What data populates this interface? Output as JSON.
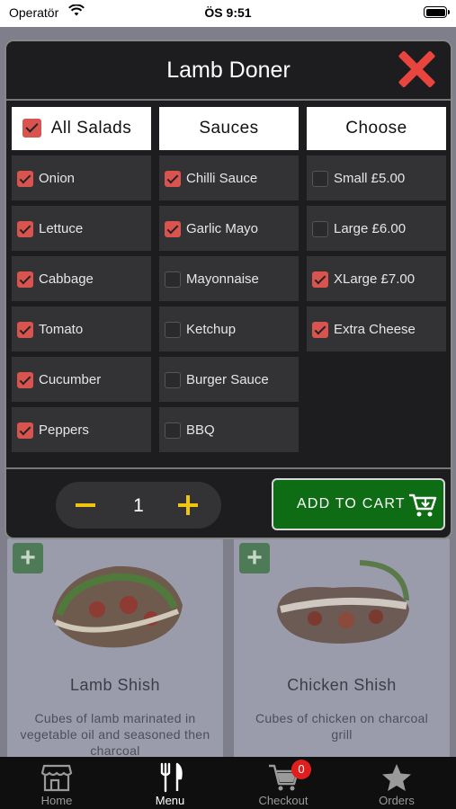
{
  "status_bar": {
    "carrier": "Operatör",
    "time": "ÖS 9:51"
  },
  "modal": {
    "title": "Lamb Doner",
    "columns": [
      {
        "header": "All Salads",
        "header_checked": true,
        "options": [
          {
            "label": "Onion",
            "checked": true
          },
          {
            "label": "Lettuce",
            "checked": true
          },
          {
            "label": "Cabbage",
            "checked": true
          },
          {
            "label": "Tomato",
            "checked": true
          },
          {
            "label": "Cucumber",
            "checked": true
          },
          {
            "label": "Peppers",
            "checked": true
          }
        ]
      },
      {
        "header": "Sauces",
        "options": [
          {
            "label": "Chilli Sauce",
            "checked": true
          },
          {
            "label": "Garlic Mayo",
            "checked": true
          },
          {
            "label": "Mayonnaise",
            "checked": false
          },
          {
            "label": "Ketchup",
            "checked": false
          },
          {
            "label": "Burger Sauce",
            "checked": false
          },
          {
            "label": "BBQ",
            "checked": false
          }
        ]
      },
      {
        "header": "Choose",
        "options": [
          {
            "label": "Small £5.00",
            "checked": false
          },
          {
            "label": "Large £6.00",
            "checked": false
          },
          {
            "label": "XLarge £7.00",
            "checked": true
          },
          {
            "label": "Extra Cheese",
            "checked": true
          }
        ]
      }
    ],
    "quantity": "1",
    "add_to_cart_label": "ADD TO CART"
  },
  "menu_items": [
    {
      "name": "Lamb Shish",
      "description": "Cubes of lamb marinated in vegetable oil and seasoned then charcoal"
    },
    {
      "name": "Chicken Shish",
      "description": "Cubes of chicken on charcoal grill"
    }
  ],
  "tabs": [
    {
      "label": "Home",
      "icon": "store-icon",
      "active": false
    },
    {
      "label": "Menu",
      "icon": "fork-knife-icon",
      "active": true
    },
    {
      "label": "Checkout",
      "icon": "cart-icon",
      "active": false,
      "badge": "0"
    },
    {
      "label": "Orders",
      "icon": "star-icon",
      "active": false
    }
  ],
  "colors": {
    "accent_red": "#e8453e",
    "checkbox_red": "#d9534f",
    "cart_green": "#0e6d14",
    "stepper_yellow": "#f1c40f"
  }
}
